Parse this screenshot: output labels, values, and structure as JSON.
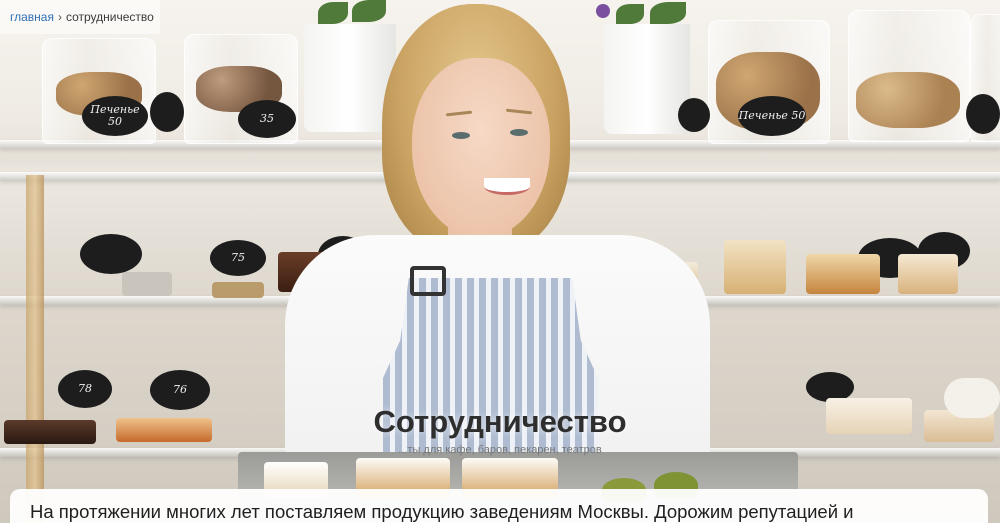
{
  "breadcrumb": {
    "home_label": "главная",
    "separator": "›",
    "current_label": "сотрудничество"
  },
  "hero": {
    "title": "Сотрудничество",
    "subtitle": "...ты для кафе, баров, пекарен, театров",
    "price_tags": [
      "Печенье 50",
      "35",
      "Печенье 50",
      "75",
      "78",
      "76"
    ]
  },
  "content": {
    "intro": "На протяжении многих лет поставляем продукцию заведениям Москвы. Дорожим репутацией и"
  },
  "colors": {
    "link": "#2f6fb3",
    "title": "#2e2e2e",
    "subtitle": "#777777",
    "card_bg": "#ffffff"
  }
}
